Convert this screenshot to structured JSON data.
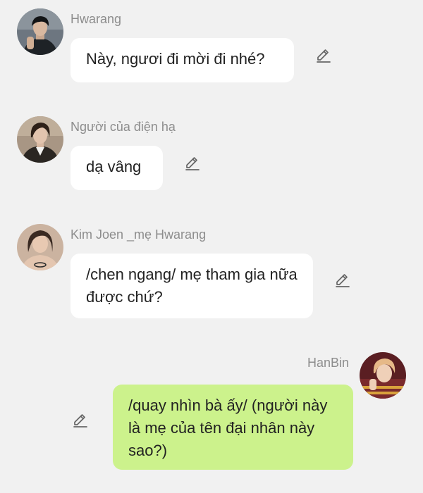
{
  "messages": [
    {
      "sender": "Hwarang",
      "text": "Này, ngươi đi mời đi nhé?",
      "avatar_icon": "avatar-hwarang",
      "outgoing": false
    },
    {
      "sender": "Người của điện hạ",
      "text": "dạ vâng",
      "avatar_icon": "avatar-servant",
      "outgoing": false
    },
    {
      "sender": "Kim Joen _mẹ Hwarang",
      "text": "/chen ngang/ mẹ tham gia nữa được chứ?",
      "avatar_icon": "avatar-kim-joen",
      "outgoing": false
    },
    {
      "sender": "HanBin",
      "text": "/quay nhìn bà ấy/ (người này là mẹ của tên đại nhân này sao?)",
      "avatar_icon": "avatar-hanbin",
      "outgoing": true
    }
  ],
  "icons": {
    "edit": "pencil-edit-icon"
  },
  "colors": {
    "background": "#f1f1f1",
    "incoming_bubble": "#ffffff",
    "outgoing_bubble": "#ccf28c",
    "name_text": "#8d8d8d",
    "message_text": "#222222"
  }
}
